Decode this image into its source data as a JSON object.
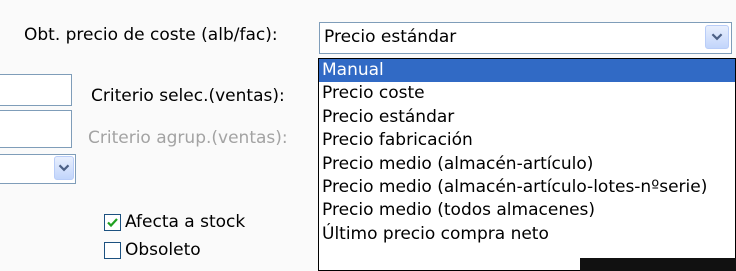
{
  "main_field": {
    "label": "Obt. precio de coste (alb/fac):",
    "value": "Precio estándar"
  },
  "criteria": {
    "sales_selection_label": "Criterio selec.(ventas):",
    "sales_grouping_label": "Criterio agrup.(ventas):"
  },
  "dropdown": {
    "selected_index": 0,
    "options": [
      "Manual",
      "Precio coste",
      "Precio estándar",
      "Precio fabricación",
      "Precio medio (almacén-artículo)",
      "Precio medio (almacén-artículo-lotes-nºserie)",
      "Precio medio (todos almacenes)",
      "Último precio compra neto"
    ]
  },
  "checkboxes": {
    "affects_stock": {
      "label": "Afecta a stock",
      "checked": true
    },
    "obsolete": {
      "label": "Obsoleto",
      "checked": false
    }
  },
  "colors": {
    "selection": "#316ac5",
    "border": "#7f9db9",
    "disabled_text": "#a3a3a3"
  },
  "icons": {
    "dropdown_arrow": "chevron-down-icon",
    "check": "checkmark-icon"
  }
}
